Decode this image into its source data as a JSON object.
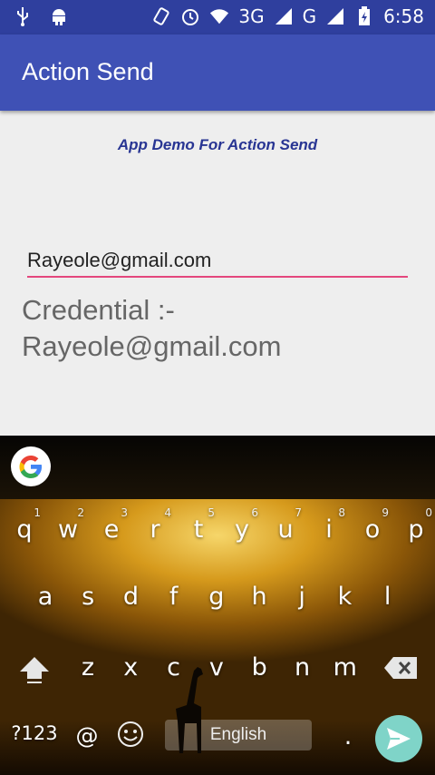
{
  "status_bar": {
    "time": "6:58",
    "network1": "3G",
    "network2": "G",
    "icons": [
      "usb-icon",
      "android-icon",
      "rotate-icon",
      "alarm-icon",
      "wifi-icon",
      "signal-icon",
      "battery-icon"
    ]
  },
  "app_bar": {
    "title": "Action Send"
  },
  "content": {
    "subtitle": "App Demo For Action Send",
    "email_value": "Rayeole@gmail.com",
    "credential_label": "Credential :-",
    "credential_value": "Rayeole@gmail.com"
  },
  "keyboard": {
    "row1": [
      {
        "k": "q",
        "n": "1"
      },
      {
        "k": "w",
        "n": "2"
      },
      {
        "k": "e",
        "n": "3"
      },
      {
        "k": "r",
        "n": "4"
      },
      {
        "k": "t",
        "n": "5"
      },
      {
        "k": "y",
        "n": "6"
      },
      {
        "k": "u",
        "n": "7"
      },
      {
        "k": "i",
        "n": "8"
      },
      {
        "k": "o",
        "n": "9"
      },
      {
        "k": "p",
        "n": "0"
      }
    ],
    "row2": [
      "a",
      "s",
      "d",
      "f",
      "g",
      "h",
      "j",
      "k",
      "l"
    ],
    "row3": [
      "z",
      "x",
      "c",
      "v",
      "b",
      "n",
      "m"
    ],
    "symbols_label": "?123",
    "at_label": "@",
    "space_label": "English",
    "colors": {
      "accent": "#e4477d",
      "enter": "#7fd4c8",
      "appbar": "#3f51b5",
      "statusbar": "#2f3f9e"
    }
  }
}
